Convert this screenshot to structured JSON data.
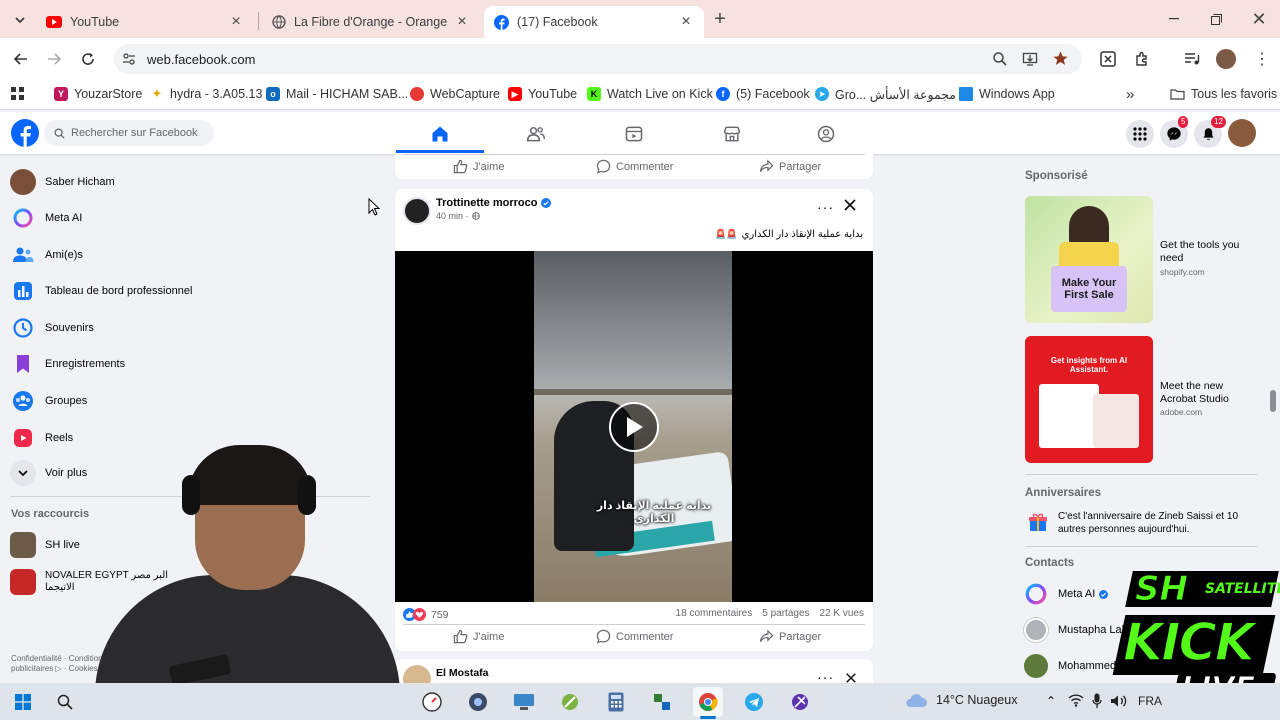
{
  "browser": {
    "tabs": [
      {
        "title": "YouTube",
        "icon": "youtube-icon"
      },
      {
        "title": "La Fibre d'Orange - Orange",
        "icon": "globe-icon"
      },
      {
        "title": "(17) Facebook",
        "icon": "facebook-icon"
      }
    ],
    "url": "web.facebook.com",
    "bookmarks": [
      "YouzarStore",
      "hydra - 3.A05.13",
      "Mail - HICHAM SAB...",
      "WebCapture",
      "YouTube",
      "Watch Live on Kick",
      "(5) Facebook",
      "Gro... مجموعة الأسأش",
      "Windows App"
    ],
    "all_bookmarks": "Tous les favoris",
    "more_bookmarks": "»"
  },
  "fb": {
    "search_placeholder": "Rechercher sur Facebook",
    "messenger_badge": "5",
    "notif_badge": "12",
    "sidebar": [
      "Saber Hicham",
      "Meta AI",
      "Ami(e)s",
      "Tableau de bord professionnel",
      "Souvenirs",
      "Enregistrements",
      "Groupes",
      "Reels",
      "Voir plus"
    ],
    "shortcuts_title": "Vos raccourcis",
    "shortcuts": [
      "SH live",
      "NOVALER EGYPT البر مصر الاتيجما"
    ],
    "footer_l1": "Confidentialité · Conditions générales",
    "footer_l2": "publicitaires ▷ · Cookies",
    "actions": {
      "like": "J'aime",
      "comment": "Commenter",
      "share": "Partager"
    },
    "post": {
      "author": "Trottinette morroco",
      "time": "40 min ·",
      "caption": "بداية عملية الإنقاذ دار الكداري",
      "video_caption": "بداية عملية الإنقاذ دار الكداري",
      "reactions": "759",
      "comments": "18 commentaires",
      "shares": "5 partages",
      "views": "22 K vues"
    },
    "next_post_author": "El Mostafa",
    "sponsored_title": "Sponsorisé",
    "ads": [
      {
        "title": "Get the tools you need",
        "domain": "shopify.com",
        "banner": "Make Your First Sale"
      },
      {
        "title": "Meet the new Acrobat Studio",
        "domain": "adobe.com",
        "banner": "Get insights from AI Assistant."
      }
    ],
    "birthday_title": "Anniversaires",
    "birthday_text": "C'est l'anniversaire de Zineb Saissi et 10 autres personnes aujourd'hui.",
    "contacts_title": "Contacts",
    "contacts": [
      "Meta AI",
      "Mustapha Laha",
      "Mohammed"
    ]
  },
  "overlay": {
    "brand_top": "SH",
    "brand_sub": "SATELLITE",
    "brand_main": "KICK",
    "brand_live": "LIVE"
  },
  "taskbar": {
    "weather": "14°C Nuageux",
    "lang": "FRA"
  },
  "colors": {
    "fb_blue": "#0866ff",
    "like_blue": "#1877f2",
    "notif_red": "#e41e3f",
    "kick_green": "#53fc18"
  }
}
